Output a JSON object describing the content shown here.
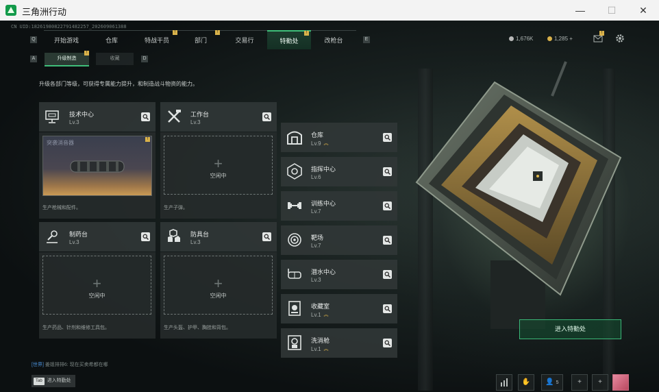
{
  "window": {
    "title": "三角洲行动",
    "minimize": "—",
    "maximize": "☐",
    "close": "✕"
  },
  "uid": "CN UID:18261980822791482257_202609061388",
  "nav": {
    "left_key": "Q",
    "right_key": "E",
    "tabs": [
      {
        "label": "开始游戏"
      },
      {
        "label": "仓库"
      },
      {
        "label": "特战干员",
        "badge": "!"
      },
      {
        "label": "部门",
        "badge": "!"
      },
      {
        "label": "交易行"
      },
      {
        "label": "特勤处",
        "badge": "!",
        "active": true
      },
      {
        "label": "改枪台"
      }
    ]
  },
  "currency": {
    "coin1": "1,676K",
    "coin2": "1,285",
    "plus": "+",
    "mail_badge": "!"
  },
  "subnav": {
    "left_key": "A",
    "right_key": "D",
    "tab1": "升级制造",
    "tab1_badge": "!",
    "tab2": "收藏"
  },
  "description": "升级各部门等级，可获得专属能力提升，和制造战斗物资的能力。",
  "workshops": [
    {
      "name": "技术中心",
      "level": "Lv.3",
      "icon": "computer-icon",
      "status": "producing",
      "product": "突袭消音器",
      "product_badge": "!",
      "text": "生产枪械和配件。"
    },
    {
      "name": "工作台",
      "level": "Lv.3",
      "icon": "tools-icon",
      "status": "idle",
      "idle_label": "空闲中",
      "text": "生产子弹。"
    },
    {
      "name": "制药台",
      "level": "Lv.3",
      "icon": "microscope-icon",
      "status": "idle",
      "idle_label": "空闲中",
      "text": "生产药品、针剂和维修工具包。"
    },
    {
      "name": "防具台",
      "level": "Lv.3",
      "icon": "armor-icon",
      "status": "idle",
      "idle_label": "空闲中",
      "text": "生产头盔、护甲、胸挂和背包。"
    }
  ],
  "facilities": [
    {
      "name": "仓库",
      "level": "Lv.9",
      "icon": "warehouse-icon",
      "upgrade": true
    },
    {
      "name": "指挥中心",
      "level": "Lv.6",
      "icon": "command-icon",
      "upgrade": false
    },
    {
      "name": "训练中心",
      "level": "Lv.7",
      "icon": "dumbbell-icon",
      "upgrade": false
    },
    {
      "name": "靶场",
      "level": "Lv.7",
      "icon": "target-icon",
      "upgrade": false
    },
    {
      "name": "潜水中心",
      "level": "Lv.3",
      "icon": "diving-icon",
      "upgrade": false
    },
    {
      "name": "收藏室",
      "level": "Lv.1",
      "icon": "collection-icon",
      "upgrade": true
    },
    {
      "name": "洗消舱",
      "level": "Lv.1",
      "icon": "hazmat-icon",
      "upgrade": true
    }
  ],
  "enter_button": "进入特勤处",
  "chat": {
    "tag": "[世界]",
    "text": "姜姐排排6: 现在买卖希都在哪"
  },
  "tab_hint": {
    "key": "Tab",
    "label": "进入特勤处"
  },
  "bottom": {
    "friends_count": "5",
    "plus": "+"
  }
}
